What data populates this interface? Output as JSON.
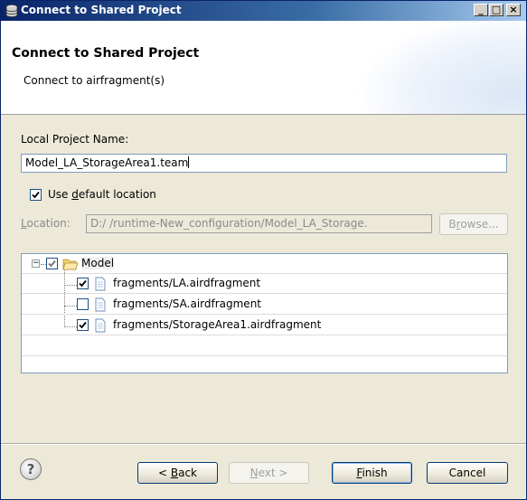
{
  "window": {
    "title": "Connect to Shared Project",
    "controls": {
      "minimize": "_",
      "maximize": "□",
      "close": "×"
    }
  },
  "banner": {
    "heading": "Connect to Shared Project",
    "description": "Connect to airfragment(s)"
  },
  "form": {
    "local_project_name_label": "Local Project Name:",
    "local_project_name_value": "Model_LA_StorageArea1.team",
    "use_default_location": {
      "checked": true,
      "label_pre": "Use ",
      "label_mnemonic": "d",
      "label_post": "efault location"
    },
    "location": {
      "label_mnemonic": "L",
      "label_rest": "ocation:",
      "value": "D:/        /runtime-New_configuration/Model_LA_Storage.",
      "browse_pre": "B",
      "browse_mnemonic": "r",
      "browse_post": "owse...",
      "enabled": false
    }
  },
  "tree": {
    "root": {
      "label": "Model",
      "checked": true,
      "partial": true,
      "expanded": true,
      "icon": "folder-open-icon"
    },
    "children": [
      {
        "label": "fragments/LA.airdfragment",
        "checked": true,
        "icon": "document-icon"
      },
      {
        "label": "fragments/SA.airdfragment",
        "checked": false,
        "icon": "document-icon"
      },
      {
        "label": "fragments/StorageArea1.airdfragment",
        "checked": true,
        "icon": "document-icon"
      }
    ]
  },
  "footer": {
    "help_icon": "question-mark-icon",
    "back": {
      "pre": "< ",
      "mnemonic": "B",
      "post": "ack",
      "enabled": true
    },
    "next": {
      "mnemonic": "N",
      "post": "ext >",
      "enabled": false
    },
    "finish": {
      "mnemonic": "F",
      "post": "inish",
      "enabled": true
    },
    "cancel": {
      "label": "Cancel",
      "enabled": true
    }
  },
  "colors": {
    "titlebar_start": "#0a246a",
    "titlebar_end": "#a6caf0",
    "dialog_bg": "#ece9d8",
    "field_border": "#7f9db9"
  }
}
